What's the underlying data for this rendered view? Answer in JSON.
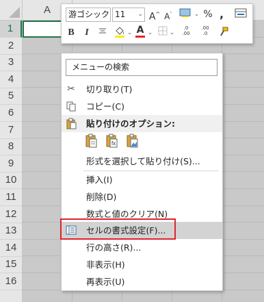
{
  "sheet": {
    "column_header": "A",
    "rows": [
      "1",
      "2",
      "3",
      "4",
      "5",
      "6",
      "7",
      "8",
      "9",
      "10",
      "11",
      "12",
      "13",
      "14",
      "15",
      "16"
    ]
  },
  "mini_toolbar": {
    "font_name": "游ゴシック",
    "font_size": "11",
    "grow_font": "A",
    "shrink_font": "A",
    "percent": "%",
    "comma": ",",
    "bold": "B",
    "italic": "I",
    "font_color_letter": "A",
    "increase_decimal": ".0 .00",
    "decrease_decimal": ".00 .0"
  },
  "menu": {
    "search": "メニューの検索",
    "cut": "切り取り(T)",
    "copy": "コピー(C)",
    "paste_options": "貼り付けのオプション:",
    "paste_special": "形式を選択して貼り付け(S)...",
    "insert": "挿入(I)",
    "delete": "削除(D)",
    "clear": "数式と値のクリア(N)",
    "format_cells": "セルの書式設定(F)...",
    "row_height": "行の高さ(R)...",
    "hide": "非表示(H)",
    "unhide": "再表示(U)"
  },
  "colors": {
    "highlight_box": "#e0242b",
    "excel_green": "#217346",
    "font_color_bar": "#e0242b",
    "fill_color_bar": "#ffeb00"
  }
}
